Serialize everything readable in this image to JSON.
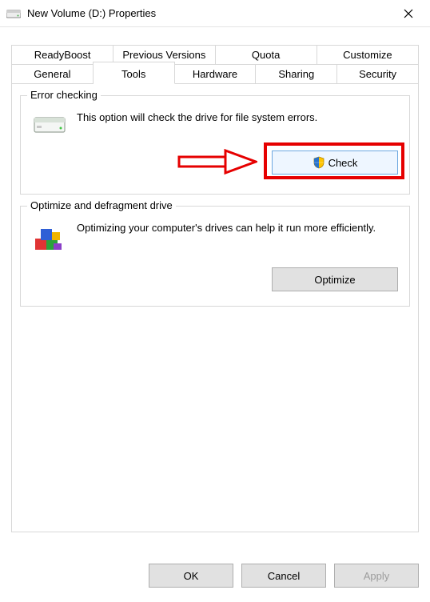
{
  "titlebar": {
    "title": "New Volume (D:) Properties"
  },
  "tabs_row1": [
    {
      "label": "ReadyBoost"
    },
    {
      "label": "Previous Versions"
    },
    {
      "label": "Quota"
    },
    {
      "label": "Customize"
    }
  ],
  "tabs_row2": [
    {
      "label": "General"
    },
    {
      "label": "Tools"
    },
    {
      "label": "Hardware"
    },
    {
      "label": "Sharing"
    },
    {
      "label": "Security"
    }
  ],
  "error_group": {
    "legend": "Error checking",
    "desc": "This option will check the drive for file system errors.",
    "button": "Check"
  },
  "optimize_group": {
    "legend": "Optimize and defragment drive",
    "desc": "Optimizing your computer's drives can help it run more efficiently.",
    "button": "Optimize"
  },
  "footer": {
    "ok": "OK",
    "cancel": "Cancel",
    "apply": "Apply"
  }
}
